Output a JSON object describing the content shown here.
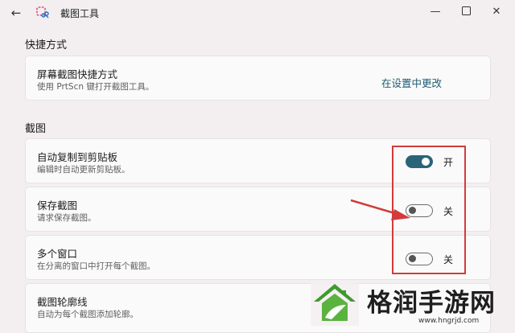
{
  "window": {
    "title": "截图工具",
    "back_glyph": "←",
    "min_glyph": "—",
    "close_glyph": "✕"
  },
  "sections": {
    "shortcut": "快捷方式",
    "capture": "截图"
  },
  "shortcut_card": {
    "title": "屏幕截图快捷方式",
    "description": "使用 PrtScn 键打开截图工具。",
    "link": "在设置中更改"
  },
  "settings": [
    {
      "title": "自动复制到剪贴板",
      "description": "编辑时自动更新剪贴板。",
      "state": "开",
      "on": true
    },
    {
      "title": "保存截图",
      "description": "请求保存截图。",
      "state": "关",
      "on": false
    },
    {
      "title": "多个窗口",
      "description": "在分离的窗口中打开每个截图。",
      "state": "关",
      "on": false
    },
    {
      "title": "截图轮廓线",
      "description": "自动为每个截图添加轮廓。"
    }
  ],
  "colors": {
    "accent": "#2a6478",
    "annotation": "#d23b3b",
    "watermark_green": "#3f9a2e"
  },
  "watermark": {
    "text": "格润手游网",
    "url": "www.hngrjd.com"
  }
}
